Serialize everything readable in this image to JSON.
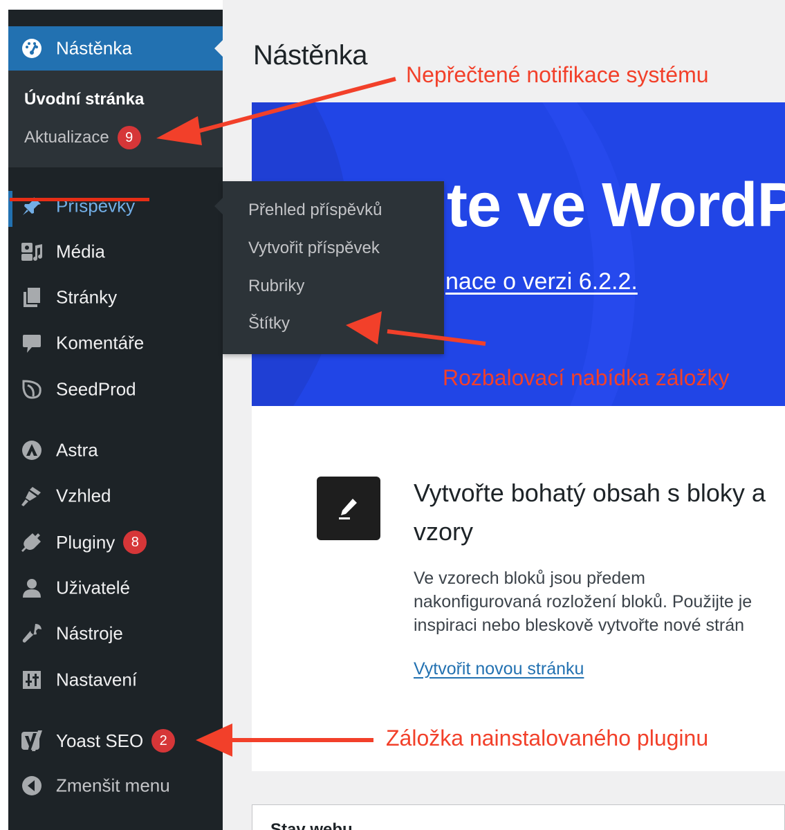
{
  "colors": {
    "sidebar_bg": "#1d2327",
    "submenu_bg": "#2c3338",
    "active_blue": "#2271b1",
    "welcome_blue": "#2145e6",
    "badge_red": "#d63638",
    "annotation_red": "#f2402a"
  },
  "sidebar": {
    "dashboard": {
      "label": "Nástěnka",
      "icon": "dashboard-gauge-icon"
    },
    "dashboard_submenu": [
      {
        "label": "Úvodní stránka",
        "current": true
      },
      {
        "label": "Aktualizace",
        "badge": "9"
      }
    ],
    "items": [
      {
        "label": "Příspěvky",
        "icon": "pin-icon",
        "active": true
      },
      {
        "label": "Média",
        "icon": "media-icon"
      },
      {
        "label": "Stránky",
        "icon": "pages-icon"
      },
      {
        "label": "Komentáře",
        "icon": "comment-icon"
      },
      {
        "label": "SeedProd",
        "icon": "seedprod-leaf-icon"
      },
      {
        "label": "Astra",
        "icon": "astra-logo-icon"
      },
      {
        "label": "Vzhled",
        "icon": "brush-icon"
      },
      {
        "label": "Pluginy",
        "icon": "plug-icon",
        "badge": "8"
      },
      {
        "label": "Uživatelé",
        "icon": "user-icon"
      },
      {
        "label": "Nástroje",
        "icon": "wrench-icon"
      },
      {
        "label": "Nastavení",
        "icon": "settings-sliders-icon"
      },
      {
        "label": "Yoast SEO",
        "icon": "yoast-logo-icon",
        "badge": "2"
      },
      {
        "label": "Zmenšit menu",
        "icon": "collapse-arrow-icon"
      }
    ],
    "posts_flyout": [
      "Přehled příspěvků",
      "Vytvořit příspěvek",
      "Rubriky",
      "Štítky"
    ]
  },
  "main": {
    "page_title": "Nástěnka",
    "welcome": {
      "heading_fragment": "te ve WordP",
      "link_fragment": "nace o verzi 6.2.2."
    },
    "blocks": {
      "heading_line1": "Vytvořte bohatý obsah s bloky a",
      "heading_line2": "vzory",
      "desc_lines": [
        "Ve vzorech bloků jsou předem",
        "nakonfigurovaná rozložení bloků. Použijte je",
        "inspiraci nebo bleskově vytvořte nové strán"
      ],
      "link": "Vytvořit novou stránku"
    },
    "site_health_title": "Stav webu"
  },
  "annotations": {
    "notifications": "Nepřečtené notifikace systému",
    "dropdown": "Rozbalovací nabídka záložky",
    "plugin_tab": "Záložka nainstalovaného pluginu"
  }
}
